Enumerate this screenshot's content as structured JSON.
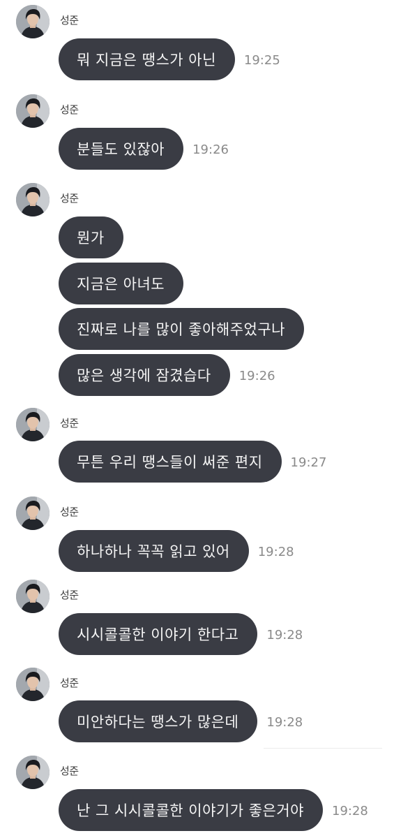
{
  "chat": {
    "groups": [
      {
        "sender": "성준",
        "messages": [
          {
            "text": "뭐 지금은 땡스가 아닌",
            "time": "19:25"
          }
        ]
      },
      {
        "sender": "성준",
        "messages": [
          {
            "text": "분들도 있잖아",
            "time": "19:26"
          }
        ]
      },
      {
        "sender": "성준",
        "messages": [
          {
            "text": "뭔가",
            "time": ""
          },
          {
            "text": "지금은 아녀도",
            "time": ""
          },
          {
            "text": "진짜로 나를 많이 좋아해주었구나",
            "time": ""
          },
          {
            "text": "많은 생각에 잠겼습다",
            "time": "19:26"
          }
        ]
      },
      {
        "sender": "성준",
        "messages": [
          {
            "text": "무튼 우리 땡스들이 써준 편지",
            "time": "19:27"
          }
        ]
      },
      {
        "sender": "성준",
        "messages": [
          {
            "text": "하나하나 꼭꼭 읽고 있어",
            "time": "19:28"
          }
        ]
      },
      {
        "sender": "성준",
        "messages": [
          {
            "text": "시시콜콜한 이야기 한다고",
            "time": "19:28"
          }
        ]
      },
      {
        "sender": "성준",
        "messages": [
          {
            "text": "미안하다는 땡스가 많은데",
            "time": "19:28"
          }
        ]
      },
      {
        "sender": "성준",
        "messages": [
          {
            "text": "난 그 시시콜콜한 이야기가 좋은거야",
            "time": "19:28"
          }
        ]
      }
    ]
  }
}
